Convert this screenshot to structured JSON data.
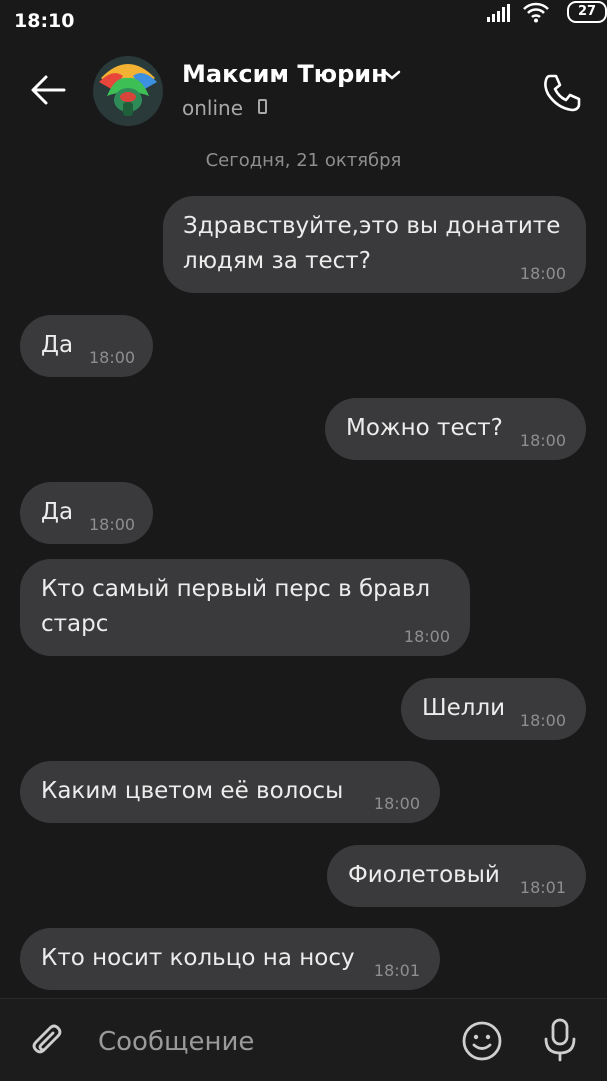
{
  "status_bar": {
    "time": "18:10",
    "battery": "27"
  },
  "header": {
    "contact_name": "Максим Тюрин",
    "status": "online"
  },
  "chat": {
    "date_separator": "Сегодня, 21 октября",
    "messages": [
      {
        "dir": "out",
        "text": "Здравствуйте,это вы донатите\nлюдям за тест?",
        "time": "18:00"
      },
      {
        "dir": "in",
        "text": "Да",
        "time": "18:00"
      },
      {
        "dir": "out",
        "text": "Можно тест?",
        "time": "18:00"
      },
      {
        "dir": "in",
        "text": "Да",
        "time": "18:00"
      },
      {
        "dir": "in",
        "text": "Кто самый первый перс в бравл\nстарс",
        "time": "18:00"
      },
      {
        "dir": "out",
        "text": "Шелли",
        "time": "18:00"
      },
      {
        "dir": "in",
        "text": "Каким цветом её волосы",
        "time": "18:00"
      },
      {
        "dir": "out",
        "text": "Фиолетовый",
        "time": "18:01"
      },
      {
        "dir": "in",
        "text": "Кто носит кольцо на носу",
        "time": "18:01"
      }
    ]
  },
  "composer": {
    "placeholder": "Сообщение"
  },
  "colors": {
    "background": "#19191a",
    "bubble": "#3a3a3c",
    "text": "#ececec",
    "meta": "#8e8e8e"
  },
  "icons": [
    "back-arrow-icon",
    "chevron-down-icon",
    "phone-icon",
    "call-icon",
    "paperclip-icon",
    "emoji-icon",
    "microphone-icon",
    "signal-icon",
    "wifi-icon"
  ]
}
